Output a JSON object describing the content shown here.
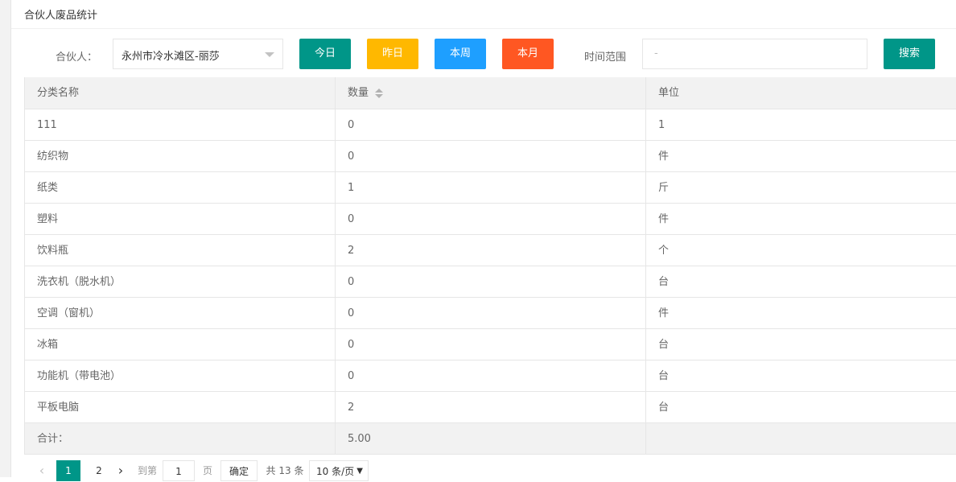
{
  "header": {
    "title": "合伙人废品统计"
  },
  "filter": {
    "partner_label": "合伙人：",
    "partner_value": "永州市冷水滩区-丽莎",
    "btn_today": "今日",
    "btn_yesterday": "昨日",
    "btn_week": "本周",
    "btn_month": "本月",
    "range_label": "时间范围",
    "range_placeholder": "-",
    "btn_search": "搜索"
  },
  "colors": {
    "teal": "#009688",
    "yellow": "#FFB800",
    "blue": "#1E9FFF",
    "orange": "#FF5722"
  },
  "table": {
    "columns": [
      "分类名称",
      "数量",
      "单位"
    ],
    "rows": [
      [
        "111",
        "0",
        "1"
      ],
      [
        "纺织物",
        "0",
        "件"
      ],
      [
        "纸类",
        "1",
        "斤"
      ],
      [
        "塑料",
        "0",
        "件"
      ],
      [
        "饮料瓶",
        "2",
        "个"
      ],
      [
        "洗衣机（脱水机）",
        "0",
        "台"
      ],
      [
        "空调（窗机）",
        "0",
        "件"
      ],
      [
        "冰箱",
        "0",
        "台"
      ],
      [
        "功能机（带电池）",
        "0",
        "台"
      ],
      [
        "平板电脑",
        "2",
        "台"
      ]
    ],
    "total_label": "合计：",
    "total_value": "5.00"
  },
  "pager": {
    "prev": "‹",
    "page1": "1",
    "page2": "2",
    "next": "›",
    "goto_label": "到第",
    "goto_value": "1",
    "page_unit": "页",
    "confirm": "确定",
    "total": "共 13 条",
    "page_size": "10 条/页"
  }
}
